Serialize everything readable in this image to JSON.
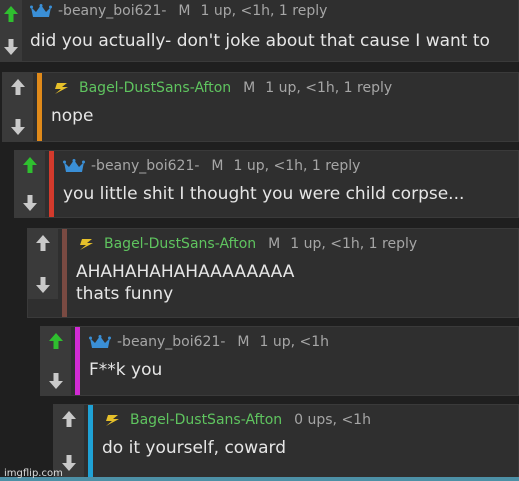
{
  "colors": {
    "bar_orange": "#e08a1a",
    "bar_red": "#d33a2c",
    "bar_brown": "#7a4a42",
    "bar_magenta": "#d12bd3",
    "bar_cyan": "#1fa2d6",
    "upvote_active": "#2fbf2f",
    "arrow_gray": "#c9c9c9",
    "username_green": "#5fc45f",
    "meta_gray": "#a6a6a6"
  },
  "comments": [
    {
      "badge": "crown-icon",
      "username": "-beany_boi621-",
      "mod": "M",
      "stats": "1 up, <1h, 1 reply",
      "text": "did you actually- don't joke about that cause I want to",
      "upvoted": true
    },
    {
      "badge": "bolt-icon",
      "username": "Bagel-DustSans-Afton",
      "mod": "M",
      "stats": "1 up, <1h, 1 reply",
      "text": "nope",
      "upvoted": false
    },
    {
      "badge": "crown-icon",
      "username": "-beany_boi621-",
      "mod": "M",
      "stats": "1 up, <1h, 1 reply",
      "text": "you little shit I thought you were child corpse...",
      "upvoted": true
    },
    {
      "badge": "bolt-icon",
      "username": "Bagel-DustSans-Afton",
      "mod": "M",
      "stats": "1 up, <1h, 1 reply",
      "text": "AHAHAHAHAHAAAAAAAA\nthats funny",
      "upvoted": false
    },
    {
      "badge": "crown-icon",
      "username": "-beany_boi621-",
      "mod": "M",
      "stats": "1 up, <1h",
      "text": "F**k you",
      "upvoted": true
    },
    {
      "badge": "bolt-icon",
      "username": "Bagel-DustSans-Afton",
      "mod": "",
      "stats": "0 ups, <1h",
      "text": "do it yourself, coward",
      "upvoted": false
    }
  ],
  "watermark": "imgflip.com"
}
